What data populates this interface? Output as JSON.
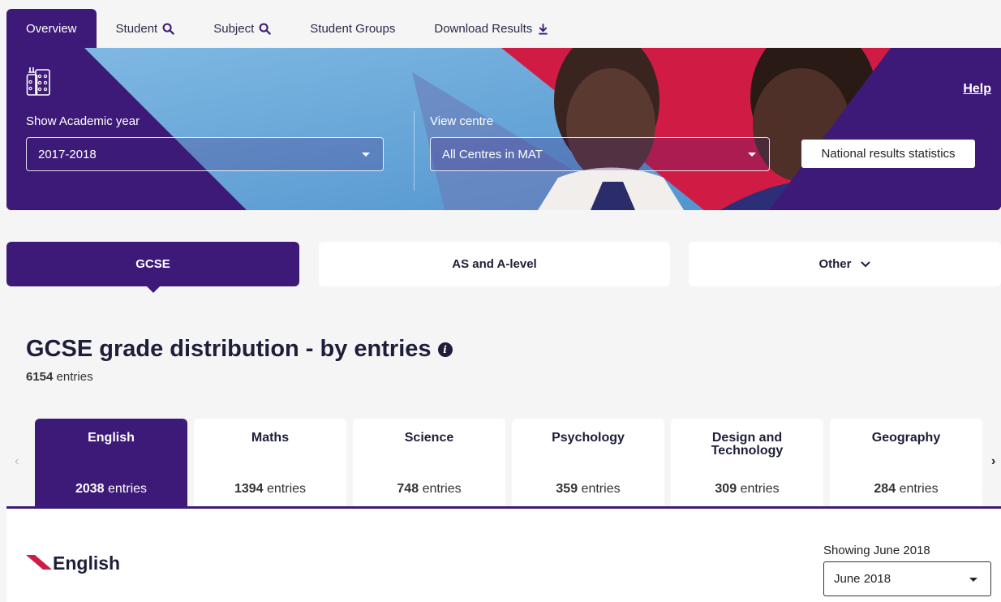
{
  "nav": {
    "tabs": [
      {
        "label": "Overview",
        "icon": ""
      },
      {
        "label": "Student",
        "icon": "search-icon"
      },
      {
        "label": "Subject",
        "icon": "search-icon"
      },
      {
        "label": "Student Groups",
        "icon": ""
      },
      {
        "label": "Download Results",
        "icon": "download-icon"
      }
    ],
    "active": "Overview"
  },
  "hero": {
    "icon": "building-icon",
    "academic_year_label": "Show Academic year",
    "academic_year_value": "2017-2018",
    "centre_label": "View centre",
    "centre_value": "All Centres in MAT",
    "help_label": "Help",
    "national_button": "National results statistics"
  },
  "qualifications": {
    "tabs": [
      "GCSE",
      "AS and A-level",
      "Other"
    ],
    "active": "GCSE"
  },
  "section": {
    "title": "GCSE grade distribution - by entries",
    "total_count": "6154",
    "entries_word": "entries"
  },
  "subjects": [
    {
      "name": "English",
      "count": "2038"
    },
    {
      "name": "Maths",
      "count": "1394"
    },
    {
      "name": "Science",
      "count": "748"
    },
    {
      "name": "Psychology",
      "count": "359"
    },
    {
      "name": "Design and Technology",
      "count": "309"
    },
    {
      "name": "Geography",
      "count": "284"
    }
  ],
  "active_subject": "English",
  "detail": {
    "title": "English",
    "showing_label": "Showing June 2018",
    "month_value": "June 2018"
  },
  "colors": {
    "primary": "#3d1a78",
    "accent_red": "#d01c45",
    "accent_blue": "#5ea2d6"
  }
}
